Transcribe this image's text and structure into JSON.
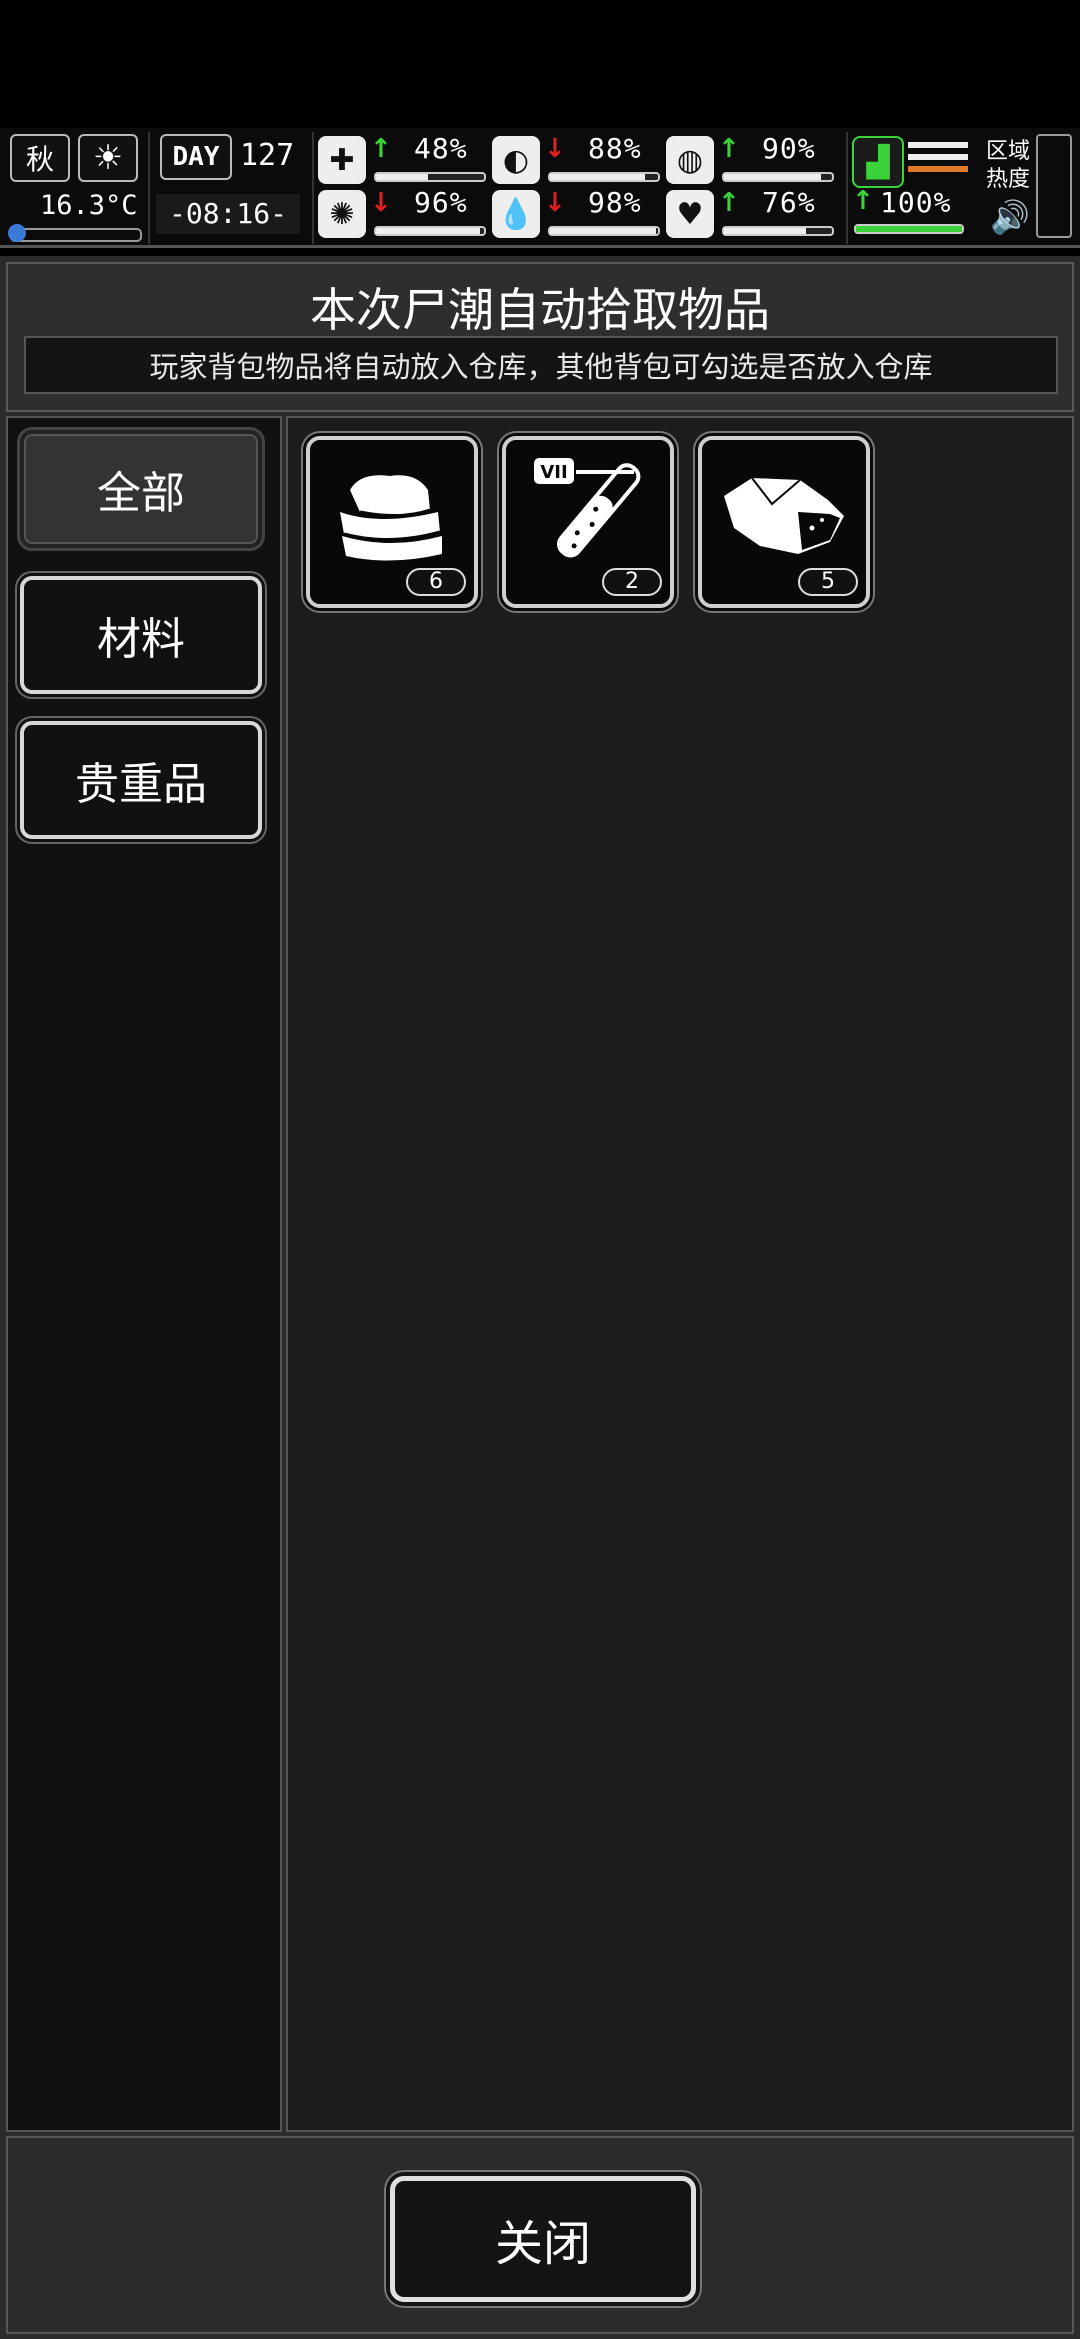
{
  "status": {
    "season": "秋",
    "temperature": "16.3°C",
    "day_label": "DAY",
    "day_number": "127",
    "time": "-08:16-",
    "zone_heat_label_line1": "区域",
    "zone_heat_label_line2": "热度",
    "stats": [
      {
        "icon": "medkit-icon",
        "trend": "up",
        "value": "48%",
        "level": 0.48
      },
      {
        "icon": "stomach-icon",
        "trend": "down",
        "value": "88%",
        "level": 0.88
      },
      {
        "icon": "pill-icon",
        "trend": "up",
        "value": "90%",
        "level": 0.9
      },
      {
        "icon": "brain-icon",
        "trend": "down",
        "value": "96%",
        "level": 0.96
      },
      {
        "icon": "water-drop-icon",
        "trend": "down",
        "value": "98%",
        "level": 0.98
      },
      {
        "icon": "heart-icon",
        "trend": "up",
        "value": "76%",
        "level": 0.76
      },
      {
        "icon": "boot-icon",
        "trend": "up",
        "value": "100%",
        "level": 1.0
      }
    ]
  },
  "panel": {
    "title": "本次尸潮自动拾取物品",
    "subtitle": "玩家背包物品将自动放入仓库，其他背包可勾选是否放入仓库"
  },
  "categories": [
    {
      "label": "全部",
      "active": true
    },
    {
      "label": "材料",
      "active": false
    },
    {
      "label": "贵重品",
      "active": false
    }
  ],
  "items": [
    {
      "icon": "cloth-icon",
      "count": "6"
    },
    {
      "icon": "test-tube-icon",
      "count": "2",
      "tag": "VII"
    },
    {
      "icon": "ore-icon",
      "count": "5"
    }
  ],
  "footer": {
    "close_label": "关闭"
  }
}
